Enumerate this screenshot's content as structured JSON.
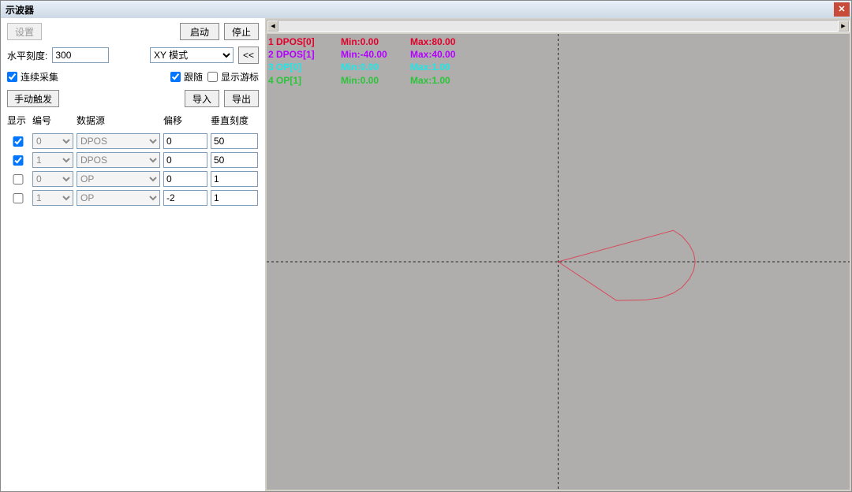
{
  "window": {
    "title": "示波器"
  },
  "buttons": {
    "settings": "设置",
    "start": "启动",
    "stop": "停止",
    "manualTrigger": "手动触发",
    "import": "导入",
    "export": "导出",
    "collapse": "<<"
  },
  "labels": {
    "horizontalScale": "水平刻度:",
    "continuousCapture": "连续采集",
    "follow": "跟随",
    "showCursor": "显示游标"
  },
  "fields": {
    "horizontalScale": "300",
    "mode": "XY 模式"
  },
  "tableHead": {
    "show": "显示",
    "id": "编号",
    "source": "数据源",
    "offset": "偏移",
    "vscale": "垂直刻度"
  },
  "channels": [
    {
      "enabled": true,
      "id": "0",
      "source": "DPOS",
      "offset": "0",
      "vscale": "50"
    },
    {
      "enabled": true,
      "id": "1",
      "source": "DPOS",
      "offset": "0",
      "vscale": "50"
    },
    {
      "enabled": false,
      "id": "0",
      "source": "OP",
      "offset": "0",
      "vscale": "1"
    },
    {
      "enabled": false,
      "id": "1",
      "source": "OP",
      "offset": "-2",
      "vscale": "1"
    }
  ],
  "overlay": [
    {
      "idx": "1 DPOS[0]",
      "min": "Min:0.00",
      "max": "Max:80.00",
      "color": "#e0002a"
    },
    {
      "idx": "2 DPOS[1]",
      "min": "Min:-40.00",
      "max": "Max:40.00",
      "color": "#b400ff"
    },
    {
      "idx": "3 OP[0]",
      "min": "Min:0.00",
      "max": "Max:1.00",
      "color": "#20e6e6"
    },
    {
      "idx": "4 OP[1]",
      "min": "Min:0.00",
      "max": "Max:1.00",
      "color": "#2cc43a"
    }
  ],
  "chart_data": {
    "type": "line",
    "title": "",
    "xlim": [
      -40,
      40
    ],
    "ylim": [
      -80,
      80
    ],
    "v_axis_frac": 0.5,
    "h_axis_frac": 0.5,
    "series": [
      {
        "name": "DPOS",
        "color": "#d64b5a",
        "x": [
          0,
          15.8,
          17.0,
          18.0,
          18.6,
          18.8,
          18.6,
          18.0,
          17.0,
          15.8,
          14.2,
          12.0,
          8.0,
          0
        ],
        "y": [
          0,
          11.0,
          9.0,
          6.0,
          3.0,
          0.0,
          -3.0,
          -6.0,
          -9.0,
          -11.0,
          -12.6,
          -13.4,
          -13.6,
          0
        ]
      }
    ]
  }
}
